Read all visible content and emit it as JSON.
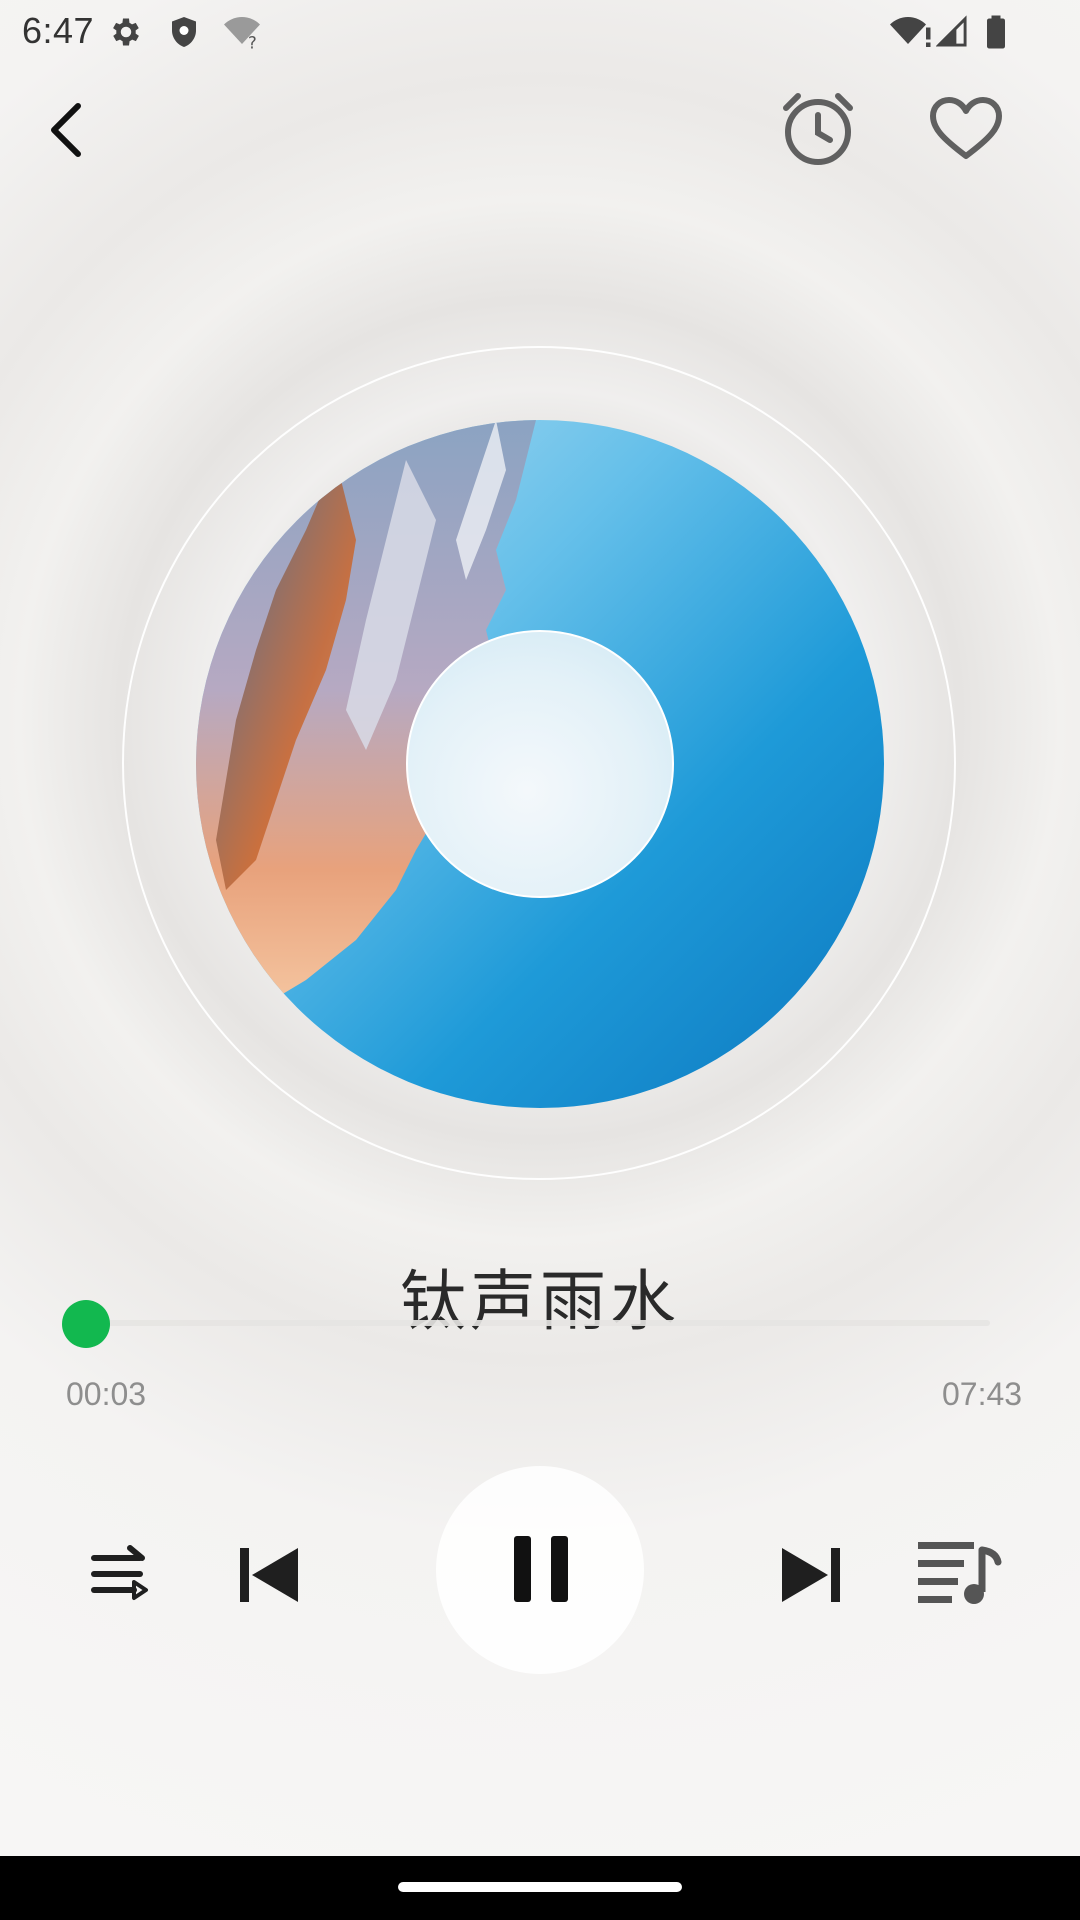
{
  "status_bar": {
    "time": "6:47",
    "left_icons": [
      "gear-icon",
      "shield-icon",
      "wifi-question-icon"
    ],
    "right_icons": [
      "wifi-alert-icon",
      "signal-icon",
      "battery-icon"
    ]
  },
  "header": {
    "back_icon": "chevron-left-icon",
    "alarm_icon": "alarm-clock-icon",
    "favorite_icon": "heart-outline-icon"
  },
  "now_playing": {
    "title": "钛声雨水",
    "elapsed": "00:03",
    "duration": "07:43",
    "progress_fraction": 0.0065
  },
  "controls": {
    "shuffle_icon": "shuffle-icon",
    "previous_icon": "skip-previous-icon",
    "play_pause_icon": "pause-icon",
    "next_icon": "skip-next-icon",
    "playlist_icon": "playlist-music-icon"
  },
  "colors": {
    "accent": "#12b84f",
    "icon": "#1f1f1f",
    "disc_blue": "#1e9ad8"
  }
}
